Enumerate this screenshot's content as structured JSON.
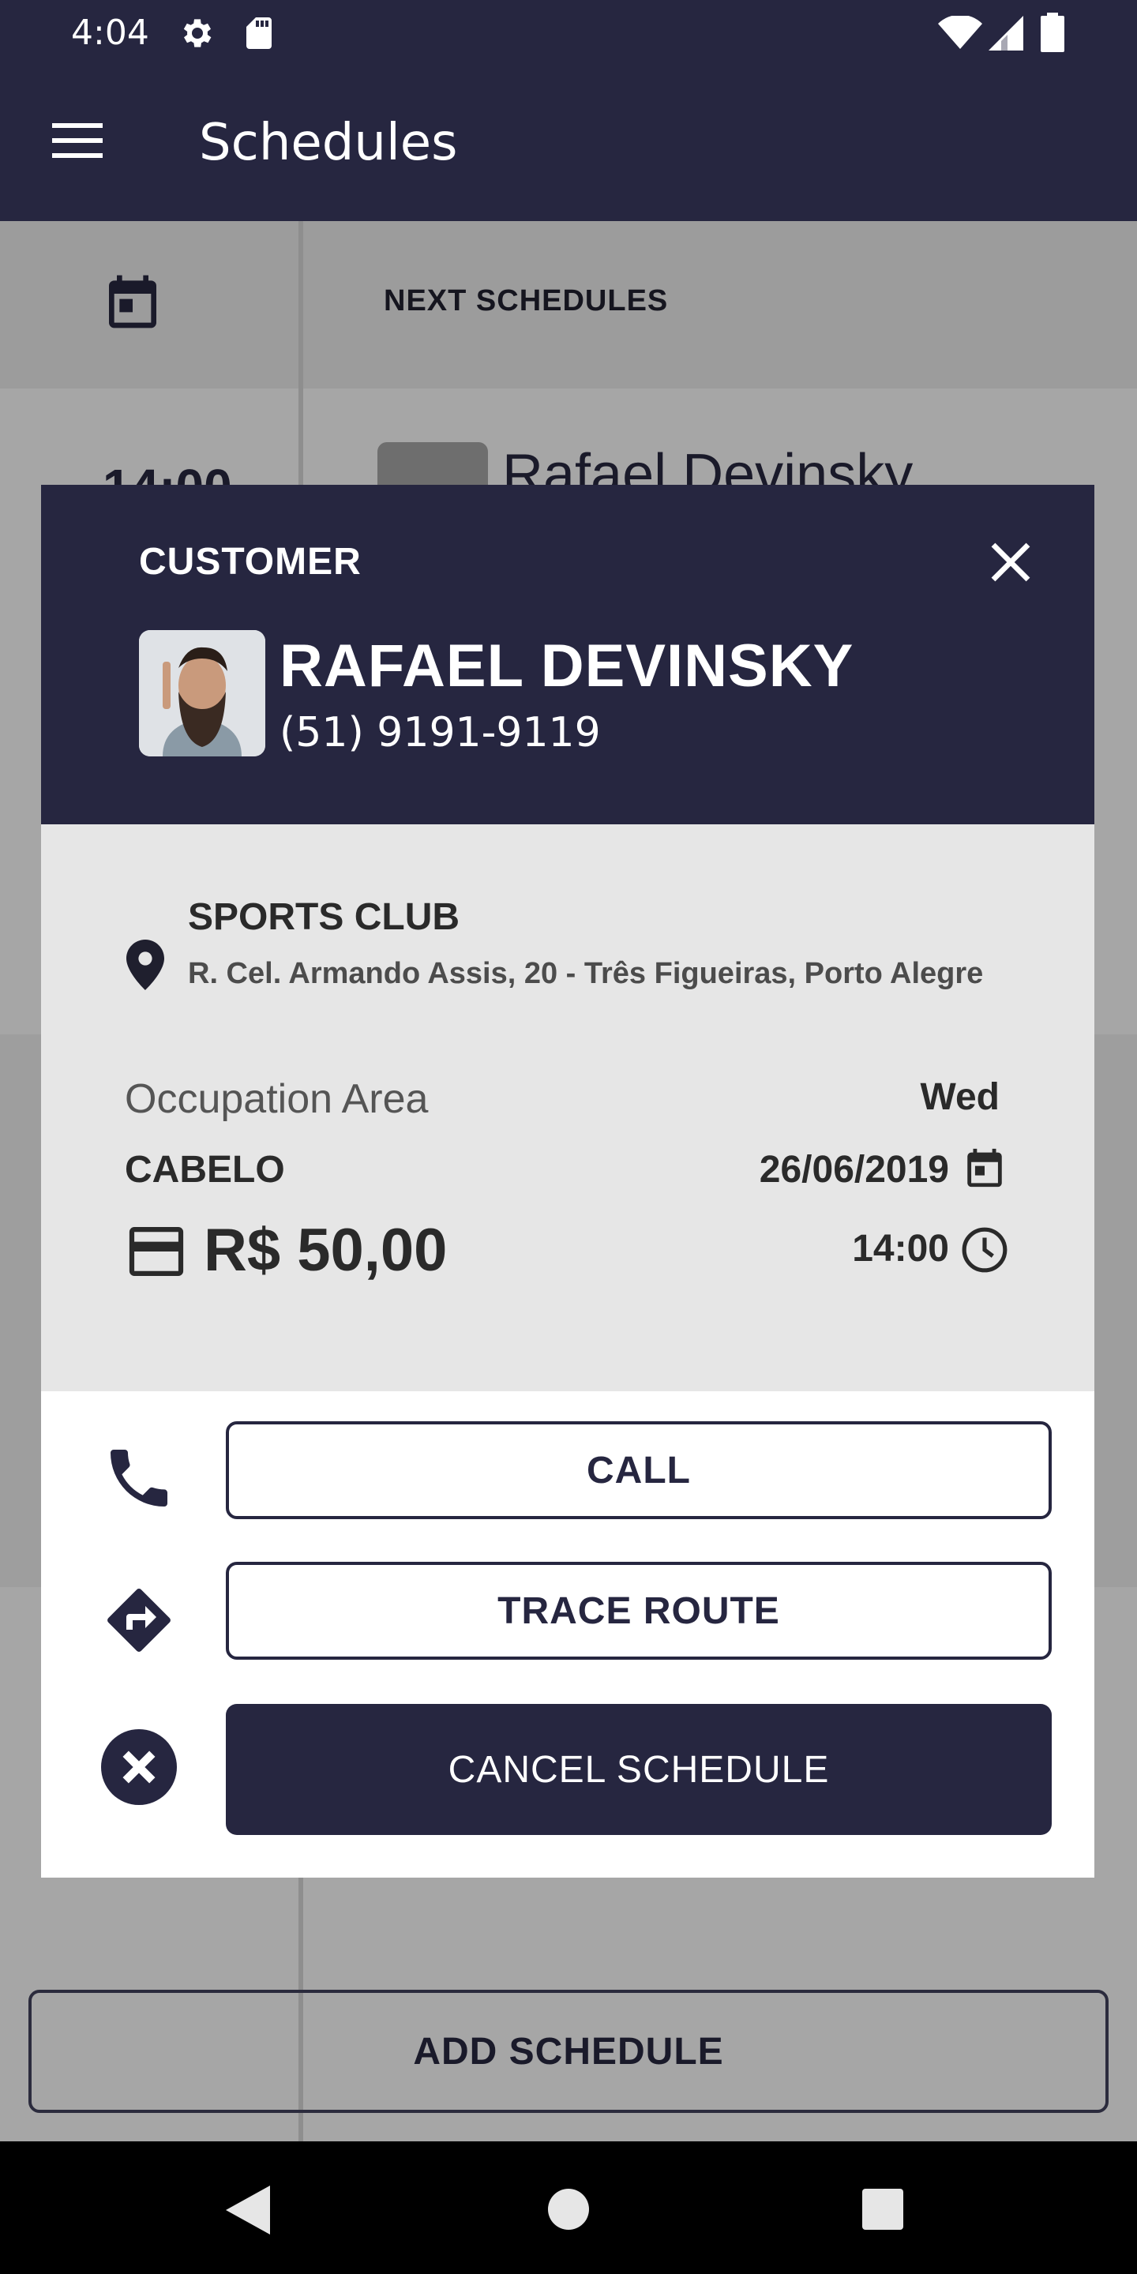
{
  "status_bar": {
    "time": "4:04",
    "icons": [
      "settings-icon",
      "sd-card-icon",
      "wifi-icon",
      "signal-icon",
      "battery-icon"
    ]
  },
  "app_bar": {
    "title": "Schedules",
    "menu_icon": "menu-icon"
  },
  "background": {
    "header_label": "NEXT SCHEDULES",
    "item_time": "14:00",
    "item_name": "Rafael Devinsky",
    "add_button": "ADD SCHEDULE"
  },
  "modal": {
    "label": "CUSTOMER",
    "customer_name": "RAFAEL DEVINSKY",
    "customer_phone": "(51) 9191-9119",
    "place_name": "SPORTS CLUB",
    "place_address": "R. Cel. Armando Assis, 20 - Três Figueiras, Porto Alegre",
    "occupation_label": "Occupation Area",
    "occupation_value": "CABELO",
    "price": "R$ 50,00",
    "day": "Wed",
    "date": "26/06/2019",
    "time": "14:00",
    "actions": {
      "call": "CALL",
      "trace_route": "TRACE ROUTE",
      "cancel": "CANCEL SCHEDULE"
    }
  },
  "colors": {
    "primary": "#262640",
    "info_bg": "#e6e6e6",
    "scrim": "#a6a6a6"
  }
}
